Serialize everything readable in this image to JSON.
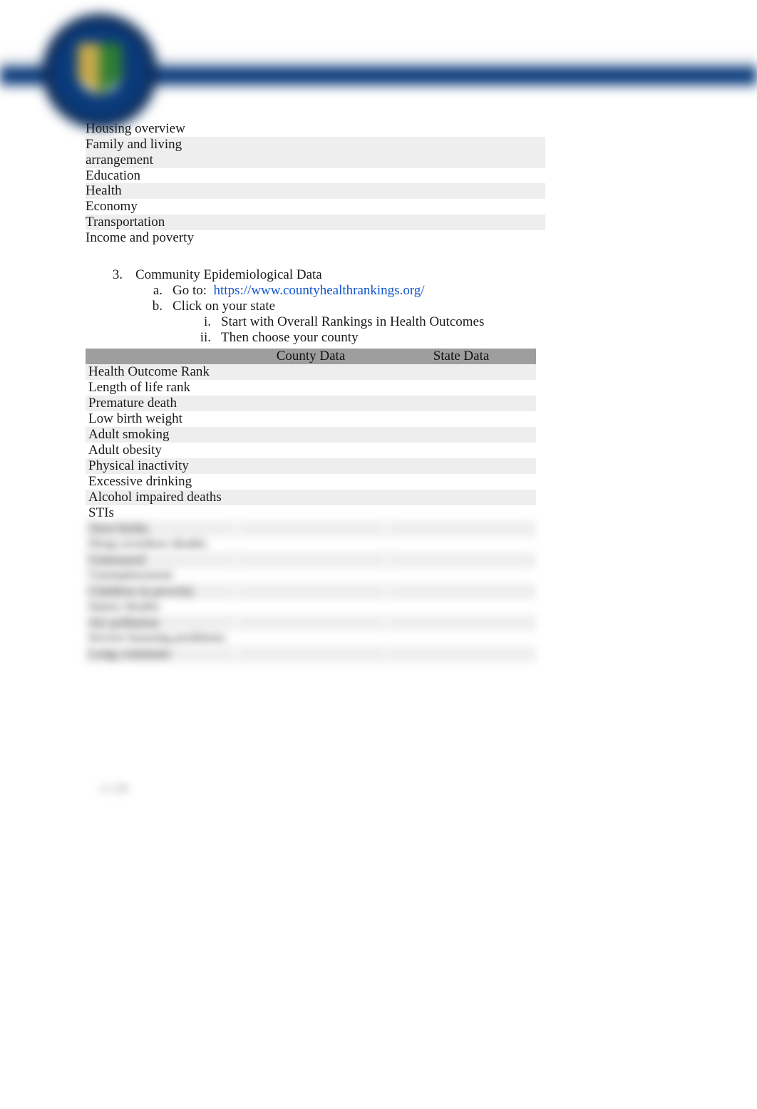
{
  "table1": {
    "rows": [
      {
        "label": "Housing overview",
        "shade": false,
        "span": 1
      },
      {
        "label": "Family and living arrangement",
        "shade": true,
        "span": 2
      },
      {
        "label": "Education",
        "shade": false,
        "span": 1
      },
      {
        "label": "Health",
        "shade": true,
        "span": 1
      },
      {
        "label": "Economy",
        "shade": false,
        "span": 1
      },
      {
        "label": "Transportation",
        "shade": true,
        "span": 1
      },
      {
        "label": "Income and poverty",
        "shade": false,
        "span": 1
      }
    ]
  },
  "section": {
    "number": "3.",
    "title": "Community Epidemiological Data",
    "a_label": "a.",
    "a_text": "Go to:",
    "a_link_text": "https://www.countyhealthrankings.org/",
    "a_link_href": "https://www.countyhealthrankings.org/",
    "b_label": "b.",
    "b_text": "Click on your state",
    "b_i_label": "i.",
    "b_i_text": "Start with Overall Rankings in Health Outcomes",
    "b_ii_label": "ii.",
    "b_ii_text": "Then choose your county"
  },
  "table2": {
    "headers": [
      "",
      "County Data",
      "State Data"
    ],
    "rows": [
      {
        "label": "Health Outcome Rank",
        "shade": true
      },
      {
        "label": "Length of life rank",
        "shade": false
      },
      {
        "label": "Premature death",
        "shade": true
      },
      {
        "label": "Low birth weight",
        "shade": false
      },
      {
        "label": "Adult smoking",
        "shade": true
      },
      {
        "label": "Adult obesity",
        "shade": false
      },
      {
        "label": "Physical inactivity",
        "shade": true
      },
      {
        "label": "Excessive drinking",
        "shade": false
      },
      {
        "label": "Alcohol impaired deaths",
        "shade": true
      },
      {
        "label": "STIs",
        "shade": false
      }
    ],
    "blurred_rows": [
      {
        "label": "Teen births",
        "shade": true
      },
      {
        "label": "Drug overdose deaths",
        "shade": false
      },
      {
        "label": "Uninsured",
        "shade": true
      },
      {
        "label": "Unemployment",
        "shade": false
      },
      {
        "label": "Children in poverty",
        "shade": true
      },
      {
        "label": "Injury deaths",
        "shade": false
      },
      {
        "label": "Air pollution",
        "shade": true
      },
      {
        "label": "Severe housing problems",
        "shade": false
      },
      {
        "label": "Long commute",
        "shade": true
      }
    ]
  },
  "footer": {
    "version": "v.1.20"
  }
}
